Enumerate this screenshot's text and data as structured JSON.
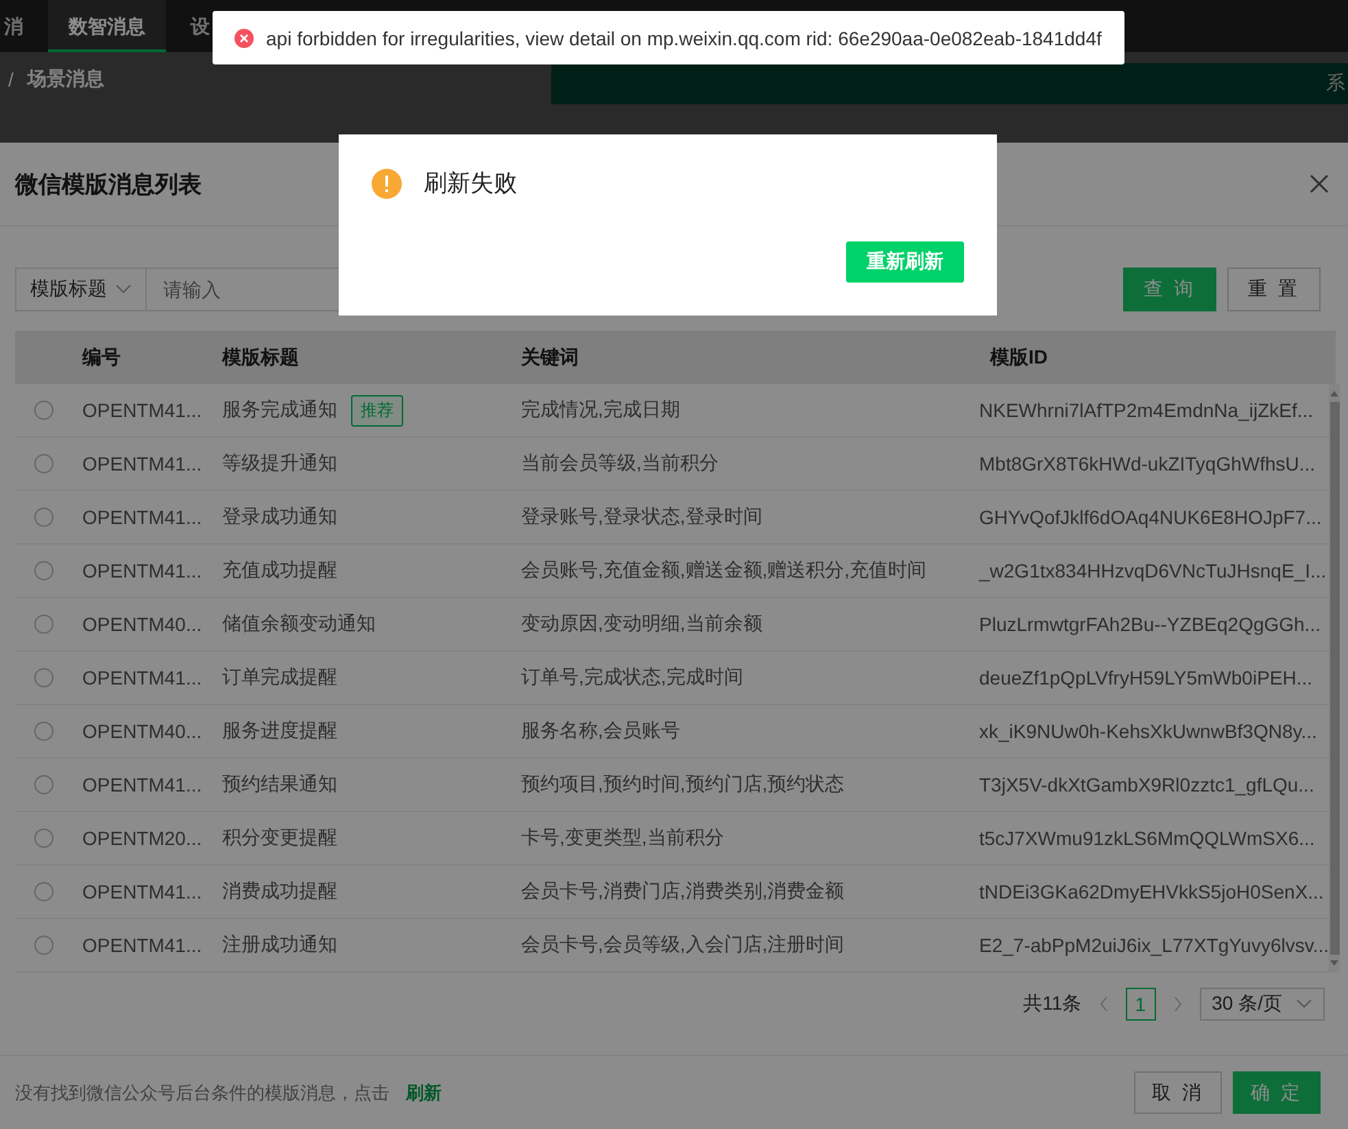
{
  "nav": {
    "items": [
      {
        "label": "消",
        "selected": false
      },
      {
        "label": "数智消息",
        "selected": true
      },
      {
        "label": "设",
        "selected": false
      }
    ]
  },
  "breadcrumb": {
    "separator": "/",
    "current": "场景消息"
  },
  "banner": {
    "text": "系"
  },
  "toast": {
    "message": "api forbidden for irregularities, view detail on mp.weixin.qq.com rid: 66e290aa-0e082eab-1841dd4f"
  },
  "dialog": {
    "title": "刷新失败",
    "button": "重新刷新"
  },
  "modal": {
    "title": "微信模版消息列表",
    "filter": {
      "field": "模版标题",
      "placeholder": "请输入"
    },
    "search_button": "查 询",
    "reset_button": "重 置",
    "table": {
      "columns": [
        "编号",
        "模版标题",
        "关键词",
        "模版ID"
      ],
      "rows": [
        {
          "selected": false,
          "id": "OPENTM41...",
          "title": "服务完成通知",
          "tag": "推荐",
          "keywords": "完成情况,完成日期",
          "template_id": "NKEWhrni7lAfTP2m4EmdnNa_ijZkEf..."
        },
        {
          "selected": false,
          "id": "OPENTM41...",
          "title": "等级提升通知",
          "keywords": "当前会员等级,当前积分",
          "template_id": "Mbt8GrX8T6kHWd-ukZITyqGhWfhsU..."
        },
        {
          "selected": false,
          "id": "OPENTM41...",
          "title": "登录成功通知",
          "keywords": "登录账号,登录状态,登录时间",
          "template_id": "GHYvQofJklf6dOAq4NUK6E8HOJpF7..."
        },
        {
          "selected": false,
          "id": "OPENTM41...",
          "title": "充值成功提醒",
          "keywords": "会员账号,充值金额,赠送金额,赠送积分,充值时间",
          "template_id": "_w2G1tx834HHzvqD6VNcTuJHsnqE_I..."
        },
        {
          "selected": false,
          "id": "OPENTM40...",
          "title": "储值余额变动通知",
          "keywords": "变动原因,变动明细,当前余额",
          "template_id": "PluzLrmwtgrFAh2Bu--YZBEq2QgGGh..."
        },
        {
          "selected": false,
          "id": "OPENTM41...",
          "title": "订单完成提醒",
          "keywords": "订单号,完成状态,完成时间",
          "template_id": "deueZf1pQpLVfryH59LY5mWb0iPEH..."
        },
        {
          "selected": false,
          "id": "OPENTM40...",
          "title": "服务进度提醒",
          "keywords": "服务名称,会员账号",
          "template_id": "xk_iK9NUw0h-KehsXkUwnwBf3QN8y..."
        },
        {
          "selected": false,
          "id": "OPENTM41...",
          "title": "预约结果通知",
          "keywords": "预约项目,预约时间,预约门店,预约状态",
          "template_id": "T3jX5V-dkXtGambX9Rl0zztc1_gfLQu..."
        },
        {
          "selected": false,
          "id": "OPENTM20...",
          "title": "积分变更提醒",
          "keywords": "卡号,变更类型,当前积分",
          "template_id": "t5cJ7XWmu91zkLS6MmQQLWmSX6..."
        },
        {
          "selected": false,
          "id": "OPENTM41...",
          "title": "消费成功提醒",
          "keywords": "会员卡号,消费门店,消费类别,消费金额",
          "template_id": "tNDEi3GKa62DmyEHVkkS5joH0SenX..."
        },
        {
          "selected": false,
          "id": "OPENTM41...",
          "title": "注册成功通知",
          "keywords": "会员卡号,会员等级,入会门店,注册时间",
          "template_id": "E2_7-abPpM2uiJ6ix_L77XTgYuvy6lvsv..."
        }
      ]
    },
    "pagination": {
      "total": "共11条",
      "pages": [
        {
          "label": "1",
          "selected": true
        }
      ],
      "page_size": "30 条/页"
    },
    "footer": {
      "text": "没有找到微信公众号后台条件的模版消息，点击",
      "link": "刷新",
      "cancel": "取 消",
      "ok": "确 定"
    }
  }
}
